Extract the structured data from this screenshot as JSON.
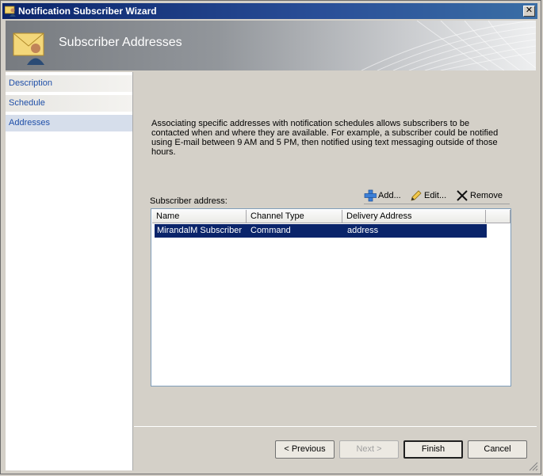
{
  "window": {
    "title": "Notification Subscriber Wizard"
  },
  "banner": {
    "title": "Subscriber Addresses",
    "icon": "envelope-user-icon"
  },
  "sidebar": {
    "items": [
      {
        "label": "Description",
        "selected": false
      },
      {
        "label": "Schedule",
        "selected": false
      },
      {
        "label": "Addresses",
        "selected": true
      }
    ]
  },
  "main": {
    "description": "Associating specific addresses with notification schedules allows subscribers to be contacted when and where they are available. For example, a subscriber could be notified using E-mail between 9 AM and 5 PM, then notified using text messaging outside of those hours.",
    "address_label": "Subscriber address:",
    "toolbar": {
      "add": "Add...",
      "edit": "Edit...",
      "remove": "Remove"
    },
    "table": {
      "columns": [
        "Name",
        "Channel Type",
        "Delivery Address"
      ],
      "rows": [
        {
          "name": "MirandalM Subscriber",
          "channel_type": "Command",
          "delivery_address": "address",
          "selected": true
        }
      ]
    }
  },
  "footer": {
    "previous": "< Previous",
    "next": "Next >",
    "finish": "Finish",
    "cancel": "Cancel"
  },
  "colors": {
    "selection": "#0a246a",
    "nav_text": "#1f4fa8"
  }
}
